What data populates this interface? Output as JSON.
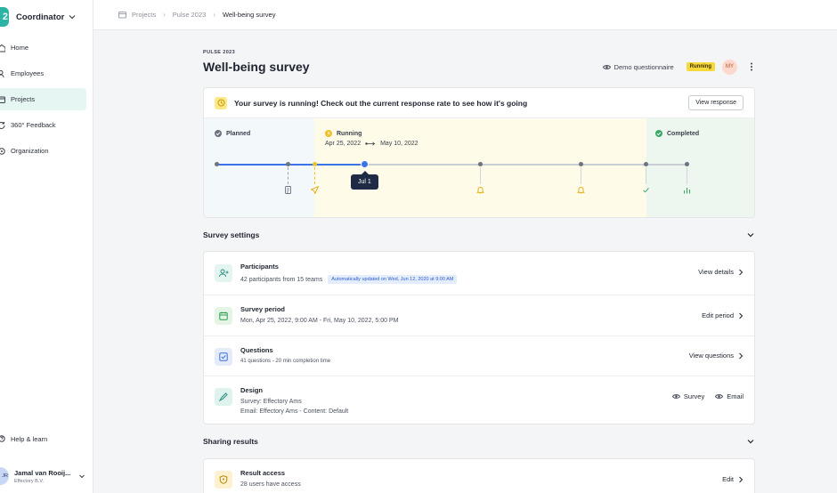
{
  "app": {
    "name": "Coordinator",
    "logo_text": "2"
  },
  "sidebar": {
    "items": [
      {
        "label": "Home",
        "icon": "home-icon",
        "active": false
      },
      {
        "label": "Employees",
        "icon": "users-icon",
        "active": false
      },
      {
        "label": "Projects",
        "icon": "folder-icon",
        "active": true
      },
      {
        "label": "360° Feedback",
        "icon": "refresh-icon",
        "active": false
      },
      {
        "label": "Organization",
        "icon": "organization-icon",
        "active": false
      }
    ],
    "help": "Help & learn",
    "user": {
      "initials": "JR",
      "name": "Jamal van Rooij...",
      "org": "Effectory B.V."
    }
  },
  "breadcrumb": {
    "items": [
      "Projects",
      "Pulse 2023",
      "Well-being survey"
    ]
  },
  "header": {
    "eyebrow": "PULSE 2023",
    "title": "Well-being survey",
    "demo_label": "Demo questionnaire",
    "status": "Running",
    "avatar": "MY"
  },
  "timeline": {
    "banner": "Your survey is running! Check out the current response rate to see how it's going",
    "view_response": "View response",
    "planned_label": "Planned",
    "running_label": "Running",
    "completed_label": "Completed",
    "start_date": "Apr 25, 2022",
    "end_date": "May 10, 2022",
    "current_label": "Jul 1",
    "progress": 0.31
  },
  "settings": {
    "title": "Survey settings",
    "participants": {
      "title": "Participants",
      "sub": "42 participants from 15 teams",
      "badge": "Automatically updated on Wed, Jun 12, 2020 at 9:00 AM",
      "action": "View details"
    },
    "period": {
      "title": "Survey period",
      "sub": "Mon, Apr 25, 2022, 9:00 AM - Fri, May 10, 2022, 5:00 PM",
      "action": "Edit period"
    },
    "questions": {
      "title": "Questions",
      "sub": "41 questions - 20 min completion time",
      "action": "View questions"
    },
    "design": {
      "title": "Design",
      "sub1": "Survey: Effectory Ams",
      "sub2": "Email: Effectory Ams - Content: Default",
      "action_survey": "Survey",
      "action_email": "Email"
    }
  },
  "sharing": {
    "title": "Sharing results",
    "access": {
      "title": "Result access",
      "sub": "28 users have access",
      "action": "Edit"
    }
  },
  "colors": {
    "accent": "#3b73e8",
    "brand": "#2bb3a3",
    "running": "#f8d93b"
  }
}
